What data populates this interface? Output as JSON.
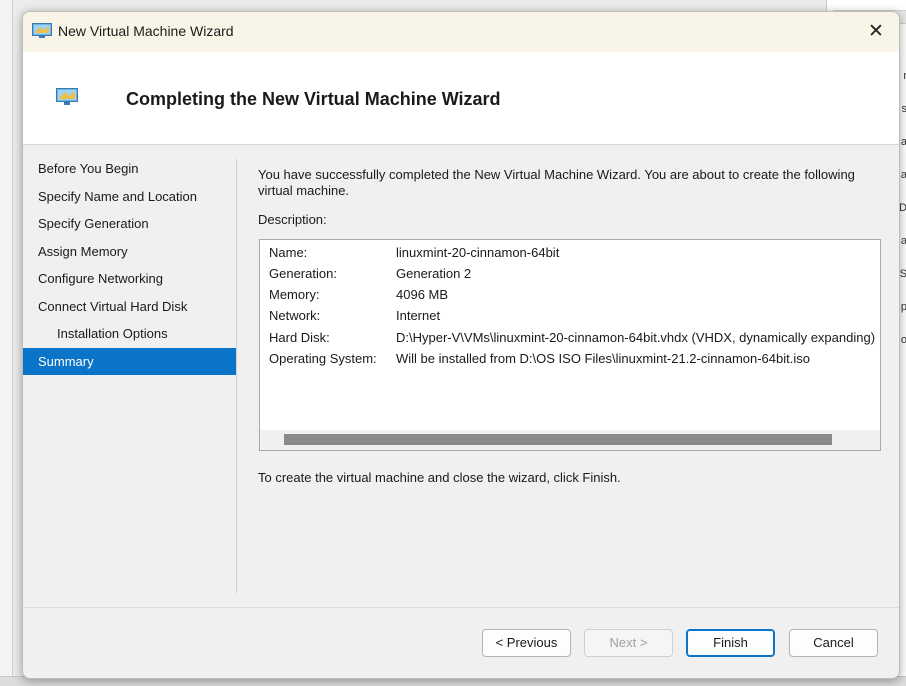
{
  "window": {
    "title": "New Virtual Machine Wizard",
    "close_glyph": "✕"
  },
  "header": {
    "title": "Completing the New Virtual Machine Wizard"
  },
  "nav": {
    "items": [
      {
        "label": "Before You Begin"
      },
      {
        "label": "Specify Name and Location"
      },
      {
        "label": "Specify Generation"
      },
      {
        "label": "Assign Memory"
      },
      {
        "label": "Configure Networking"
      },
      {
        "label": "Connect Virtual Hard Disk"
      },
      {
        "label": "Installation Options"
      },
      {
        "label": "Summary",
        "selected": true
      }
    ]
  },
  "content": {
    "intro": "You have successfully completed the New Virtual Machine Wizard. You are about to create the following virtual machine.",
    "description_label": "Description:",
    "summary": [
      {
        "key": "Name:",
        "value": "linuxmint-20-cinnamon-64bit"
      },
      {
        "key": "Generation:",
        "value": "Generation 2"
      },
      {
        "key": "Memory:",
        "value": "4096 MB"
      },
      {
        "key": "Network:",
        "value": "Internet"
      },
      {
        "key": "Hard Disk:",
        "value": "D:\\Hyper-V\\VMs\\linuxmint-20-cinnamon-64bit.vhdx (VHDX, dynamically expanding)"
      },
      {
        "key": "Operating System:",
        "value": "Will be installed from D:\\OS ISO Files\\linuxmint-21.2-cinnamon-64bit.iso"
      }
    ],
    "finish_note": "To create the virtual machine and close the wizard, click Finish."
  },
  "buttons": {
    "previous": "< Previous",
    "next": "Next >",
    "finish": "Finish",
    "cancel": "Cancel"
  },
  "colors": {
    "selection": "#0a74c8",
    "titlebar": "#f8f5e8"
  },
  "background": {
    "right_edge_letters": [
      "r",
      "s",
      "a",
      "a",
      "D",
      "a",
      "S",
      "p",
      "o"
    ]
  }
}
